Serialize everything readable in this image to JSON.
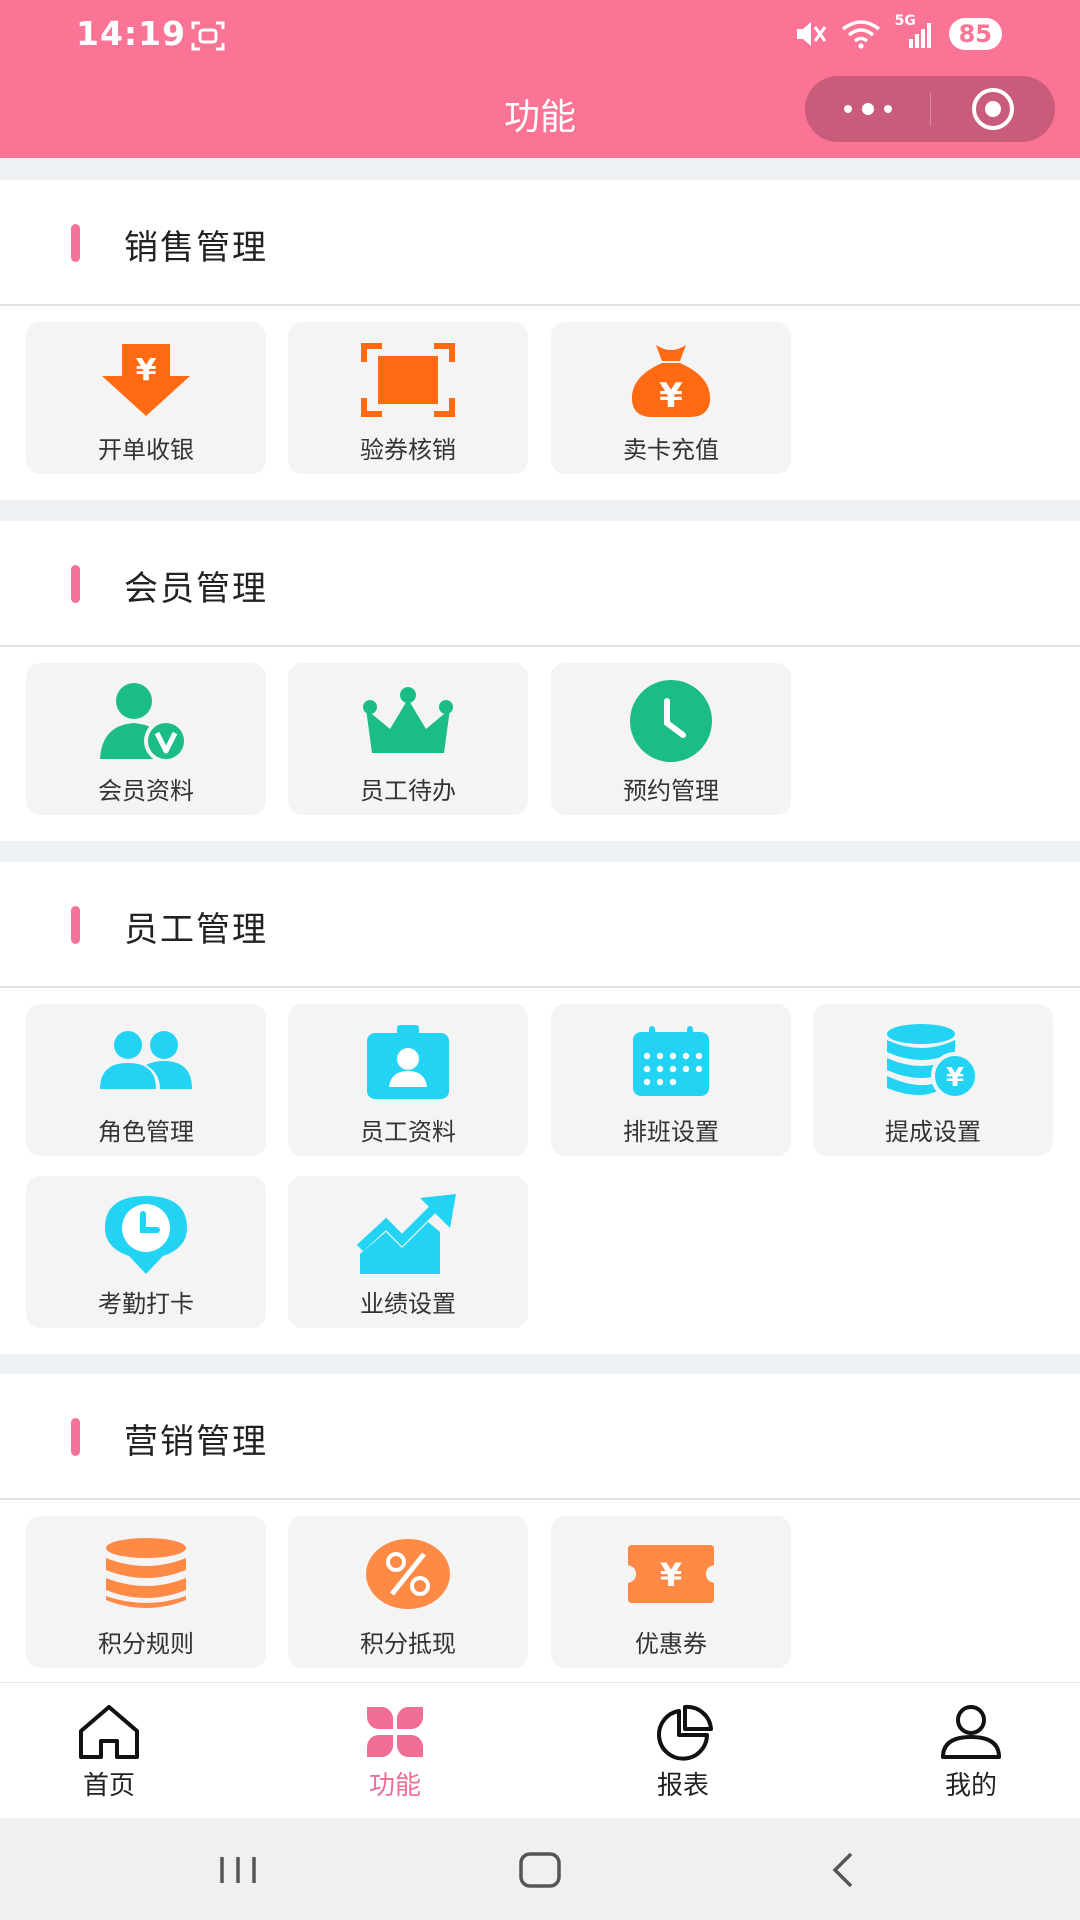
{
  "status_bar": {
    "time": "14:19",
    "battery": "85",
    "network": "5G"
  },
  "header": {
    "title": "功能"
  },
  "colors": {
    "header": "#fb7395",
    "accent": "#f5739b",
    "orange": "#ff6a13",
    "green": "#1bbd84",
    "cyan": "#22d3f3",
    "marketing": "#ff8a45"
  },
  "sections": [
    {
      "title": "销售管理",
      "items": [
        {
          "label": "开单收银",
          "icon": "cashier-arrow-icon"
        },
        {
          "label": "验券核销",
          "icon": "scan-square-icon"
        },
        {
          "label": "卖卡充值",
          "icon": "money-bag-icon"
        }
      ]
    },
    {
      "title": "会员管理",
      "items": [
        {
          "label": "会员资料",
          "icon": "vip-user-icon"
        },
        {
          "label": "员工待办",
          "icon": "crown-icon"
        },
        {
          "label": "预约管理",
          "icon": "clock-icon"
        }
      ]
    },
    {
      "title": "员工管理",
      "items": [
        {
          "label": "角色管理",
          "icon": "users-icon"
        },
        {
          "label": "员工资料",
          "icon": "id-card-icon"
        },
        {
          "label": "排班设置",
          "icon": "calendar-icon"
        },
        {
          "label": "提成设置",
          "icon": "coins-stack-icon"
        },
        {
          "label": "考勤打卡",
          "icon": "location-clock-icon"
        },
        {
          "label": "业绩设置",
          "icon": "trend-up-icon"
        }
      ]
    },
    {
      "title": "营销管理",
      "items": [
        {
          "label": "积分规则",
          "icon": "database-icon"
        },
        {
          "label": "积分抵现",
          "icon": "percent-icon"
        },
        {
          "label": "优惠券",
          "icon": "coupon-icon"
        }
      ]
    }
  ],
  "tabbar": [
    {
      "label": "首页",
      "icon": "home-icon",
      "active": false
    },
    {
      "label": "功能",
      "icon": "grid-icon",
      "active": true
    },
    {
      "label": "报表",
      "icon": "pie-chart-icon",
      "active": false
    },
    {
      "label": "我的",
      "icon": "user-icon",
      "active": false
    }
  ]
}
